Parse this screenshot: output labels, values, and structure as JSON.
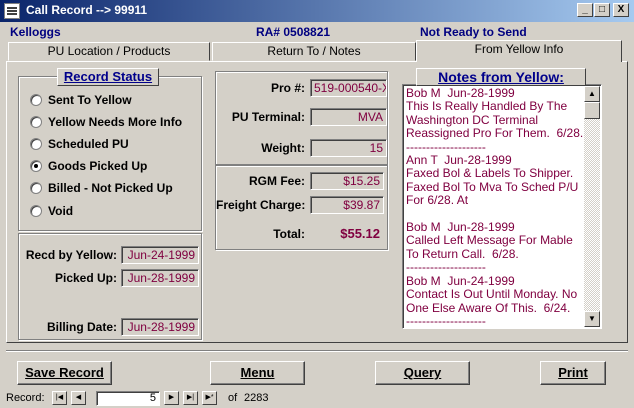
{
  "window": {
    "title": "Call Record --> 99911",
    "controls": [
      "_",
      "□",
      "X"
    ]
  },
  "header": {
    "customer": "Kelloggs",
    "ra": "RA# 0508821",
    "status": "Not Ready to Send"
  },
  "tabs": [
    {
      "label": "PU Location / Products"
    },
    {
      "label": "Return To / Notes"
    },
    {
      "label": "From Yellow Info"
    }
  ],
  "record_status": {
    "title": "Record Status",
    "options": [
      {
        "label": "Sent To Yellow",
        "selected": false
      },
      {
        "label": "Yellow Needs More Info",
        "selected": false
      },
      {
        "label": "Scheduled PU",
        "selected": false
      },
      {
        "label": "Goods Picked Up",
        "selected": true
      },
      {
        "label": "Billed - Not Picked Up",
        "selected": false
      },
      {
        "label": "Void",
        "selected": false
      }
    ]
  },
  "dates": {
    "recd_label": "Recd by Yellow:",
    "recd_value": "Jun-24-1999",
    "picked_label": "Picked Up:",
    "picked_value": "Jun-28-1999",
    "billing_label": "Billing Date:",
    "billing_value": "Jun-28-1999"
  },
  "shipment": {
    "pro_label": "Pro #:",
    "pro_value": "519-000540-X",
    "terminal_label": "PU Terminal:",
    "terminal_value": "MVA",
    "weight_label": "Weight:",
    "weight_value": "15"
  },
  "fees": {
    "rgm_label": "RGM Fee:",
    "rgm_value": "$15.25",
    "freight_label": "Freight Charge:",
    "freight_value": "$39.87",
    "total_label": "Total:",
    "total_value": "$55.12"
  },
  "notes": {
    "title": "Notes from Yellow:",
    "text": "Bob M  Jun-28-1999\nThis Is Really Handled By The Washington DC Terminal Reassigned Pro For Them.  6/28.\n--------------------\nAnn T  Jun-28-1999\nFaxed Bol & Labels To Shipper. Faxed Bol To Mva To Sched P/U For 6/28. At\n\nBob M  Jun-28-1999\nCalled Left Message For Mable To Return Call.  6/28.\n--------------------\nBob M  Jun-24-1999\nContact Is Out Until Monday. No One Else Aware Of This.  6/24.\n--------------------"
  },
  "buttons": {
    "save": "Save Record",
    "menu": "Menu",
    "query": "Query",
    "print": "Print"
  },
  "record_nav": {
    "label": "Record:",
    "current": "5",
    "of_label": "of",
    "total": "2283"
  }
}
